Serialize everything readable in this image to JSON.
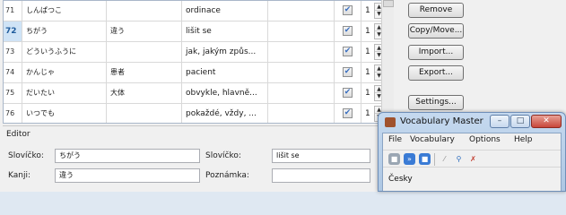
{
  "table": {
    "rows": [
      {
        "index": "71",
        "reading": "しんぱつこ",
        "kanji": "",
        "meaning": "ordinace",
        "extra": "",
        "checked": "✔",
        "count": "1",
        "selected": false
      },
      {
        "index": "72",
        "reading": "ちがう",
        "kanji": "違う",
        "meaning": "lišit se",
        "extra": "",
        "checked": "✔",
        "count": "1",
        "selected": true
      },
      {
        "index": "73",
        "reading": "どういうふうに",
        "kanji": "",
        "meaning": "jak, jakým způs...",
        "extra": "",
        "checked": "✔",
        "count": "1",
        "selected": false
      },
      {
        "index": "74",
        "reading": "かんじゃ",
        "kanji": "患者",
        "meaning": "pacient",
        "extra": "",
        "checked": "✔",
        "count": "1",
        "selected": false
      },
      {
        "index": "75",
        "reading": "だいたい",
        "kanji": "大体",
        "meaning": "obvykle, hlavně...",
        "extra": "",
        "checked": "✔",
        "count": "1",
        "selected": false
      },
      {
        "index": "76",
        "reading": "いつでも",
        "kanji": "",
        "meaning": "pokaždé, vždy, ...",
        "extra": "",
        "checked": "✔",
        "count": "1",
        "selected": false
      }
    ]
  },
  "buttons": {
    "remove": "Remove",
    "copy_move": "Copy/Move...",
    "import": "Import...",
    "export": "Export...",
    "settings": "Settings..."
  },
  "editor": {
    "group_label": "Editor",
    "slovicko_label_1": "Slovíčko:",
    "slovicko_value_1": "ちがう",
    "slovicko_label_2": "Slovíčko:",
    "slovicko_value_2": "lišit se",
    "kanji_label": "Kanji:",
    "kanji_value": "違う",
    "poznamka_label": "Poznámka:",
    "poznamka_value": ""
  },
  "popup": {
    "title": "Vocabulary Master",
    "menu": [
      "File",
      "Vocabulary",
      "Options",
      "Help"
    ],
    "language": "Česky",
    "toolbar_icons": [
      "stop-icon",
      "forward-icon",
      "pause-icon",
      "wand-icon",
      "search-icon",
      "delete-icon"
    ]
  },
  "colors": {
    "selection": "#cfe3f6",
    "title_bar": "#b8cfe9",
    "accent_blue": "#3a7bd5"
  }
}
